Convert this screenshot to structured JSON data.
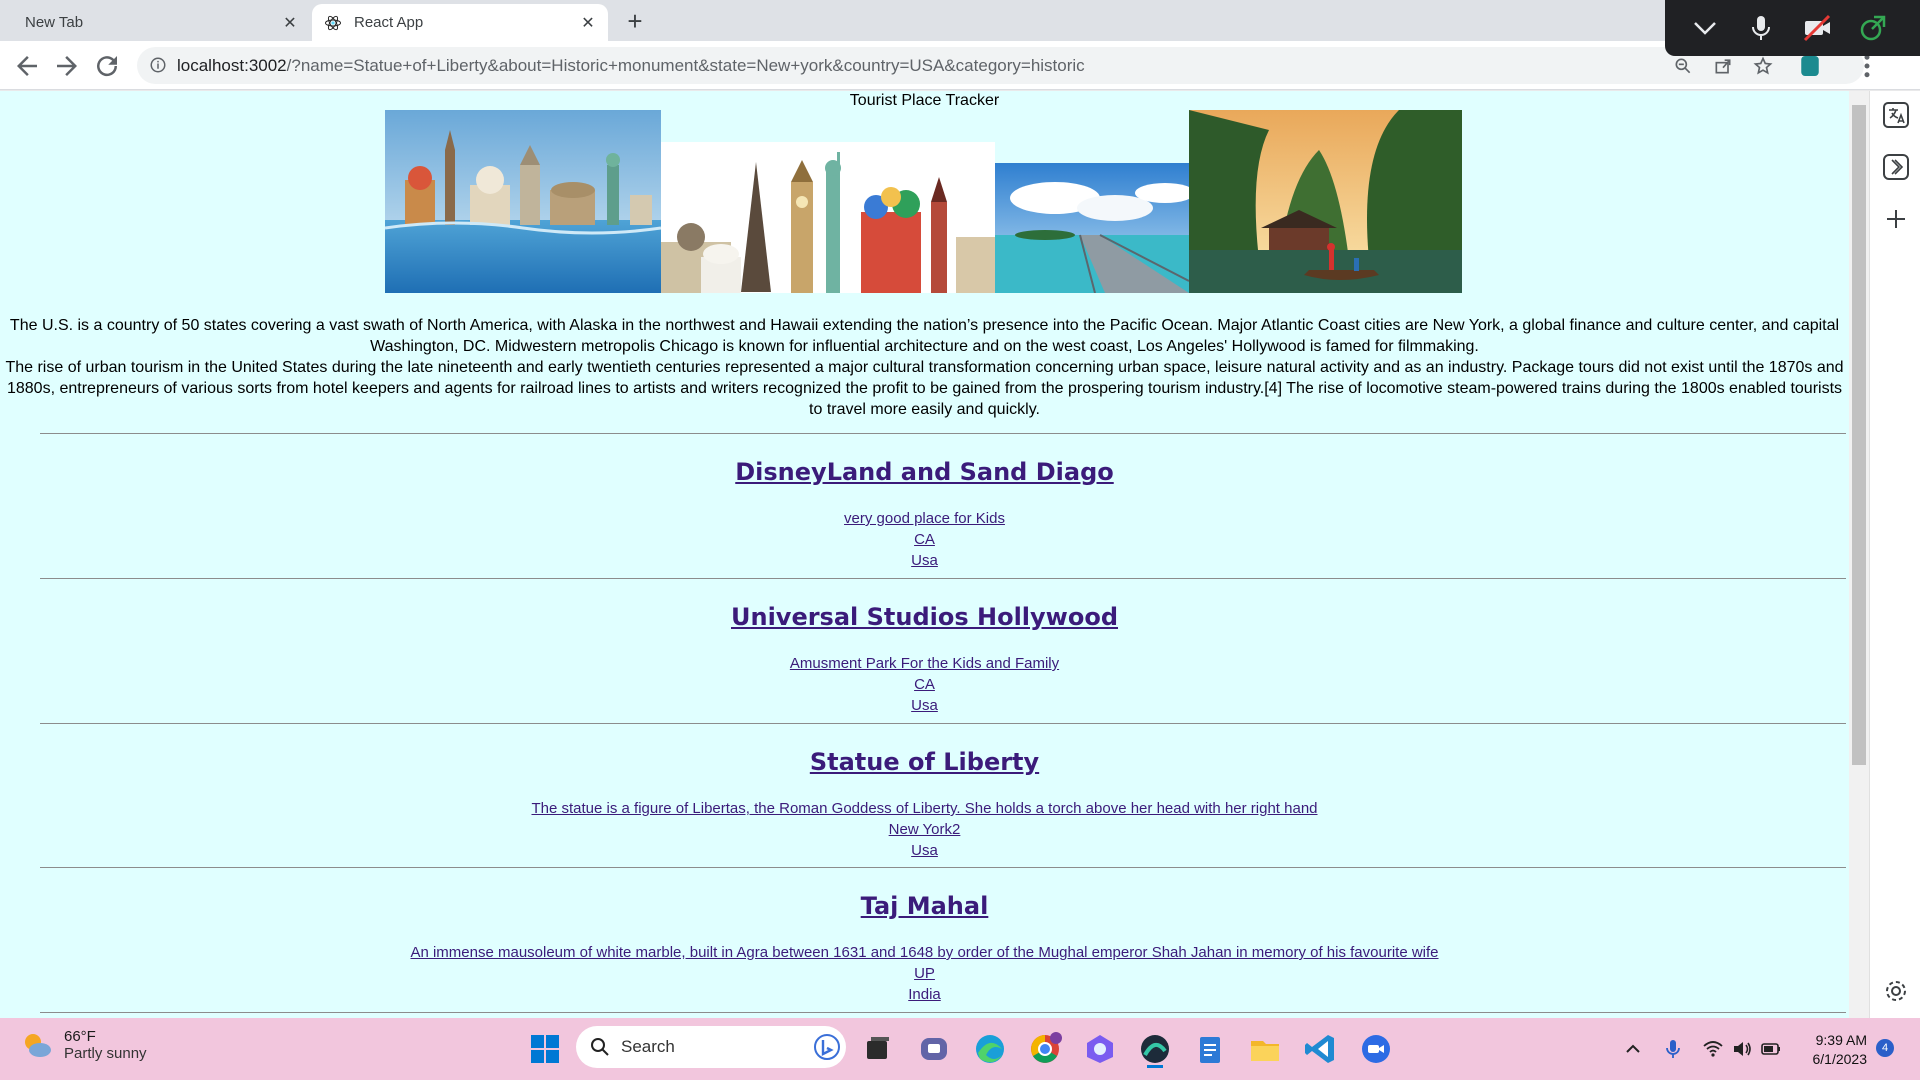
{
  "browser": {
    "tabs": [
      {
        "title": "New Tab",
        "active": false
      },
      {
        "title": "React App",
        "active": true
      }
    ],
    "url_host": "localhost:3002",
    "url_path": "/?name=Statue+of+Liberty&about=Historic+monument&state=New+york&country=USA&category=historic"
  },
  "page": {
    "title": "Tourist Place Tracker",
    "description_1": "The U.S. is a country of 50 states covering a vast swath of North America, with Alaska in the northwest and Hawaii extending the nation’s presence into the Pacific Ocean. Major Atlantic Coast cities are New York, a global finance and culture center, and capital Washington, DC. Midwestern metropolis Chicago is known for influential architecture and on the west coast, Los Angeles' Hollywood is famed for filmmaking.",
    "description_2": "The rise of urban tourism in the United States during the late nineteenth and early twentieth centuries represented a major cultural transformation concerning urban space, leisure natural activity and as an industry. Package tours did not exist until the 1870s and 1880s, entrepreneurs of various sorts from hotel keepers and agents for railroad lines to artists and writers recognized the profit to be gained from the prospering tourism industry.[4] The rise of locomotive steam-powered trains during the 1800s enabled tourists to travel more easily and quickly.",
    "places": [
      {
        "name": "DisneyLand and Sand Diago",
        "about": "very good place for Kids",
        "state": "CA",
        "country": "Usa"
      },
      {
        "name": "Universal Studios Hollywood",
        "about": "Amusment Park For the Kids and Family",
        "state": "CA",
        "country": "Usa"
      },
      {
        "name": "Statue of Liberty",
        "about": "The statue is a figure of Libertas, the Roman Goddess of Liberty. She holds a torch above her head with her right hand",
        "state": "New York2",
        "country": "Usa"
      },
      {
        "name": "Taj Mahal",
        "about": "An immense mausoleum of white marble, built in Agra between 1631 and 1648 by order of the Mughal emperor Shah Jahan in memory of his favourite wife",
        "state": "UP",
        "country": "India"
      }
    ]
  },
  "taskbar": {
    "weather_temp": "66°F",
    "weather_cond": "Partly sunny",
    "search_label": "Search",
    "time": "9:39 AM",
    "date": "6/1/2023",
    "notification_count": "4"
  },
  "colors": {
    "page_bg": "#e0ffff",
    "link": "#3b1b7a",
    "taskbar_bg": "#f2c6dd"
  }
}
